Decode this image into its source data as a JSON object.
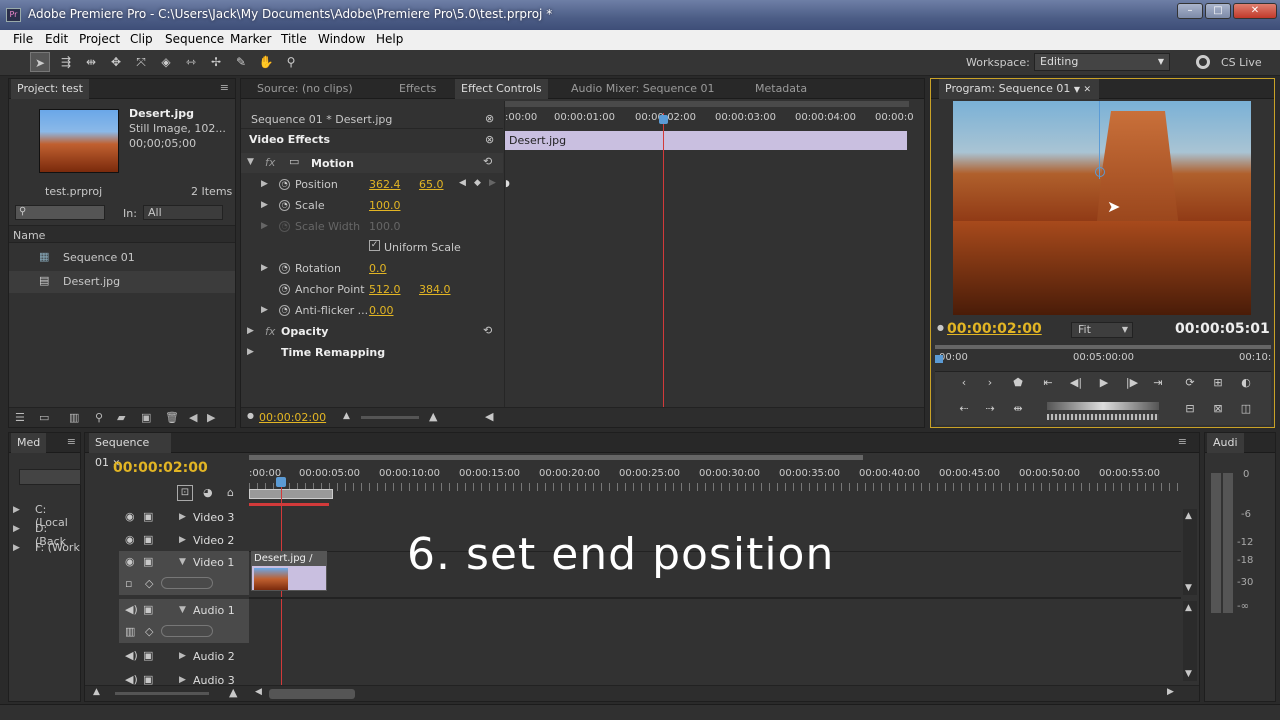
{
  "window": {
    "title": "Adobe Premiere Pro - C:\\Users\\Jack\\My Documents\\Adobe\\Premiere Pro\\5.0\\test.prproj *",
    "logo": "Pr",
    "min": "–",
    "max": "□",
    "close": "✕"
  },
  "menu": [
    "File",
    "Edit",
    "Project",
    "Clip",
    "Sequence",
    "Marker",
    "Title",
    "Window",
    "Help"
  ],
  "toolbar": {
    "workspace_label": "Workspace:",
    "workspace_value": "Editing",
    "cslive": "CS Live"
  },
  "project": {
    "tab": "Project: test",
    "clip_name": "Desert.jpg",
    "clip_type": "Still Image, 102...",
    "clip_duration": "00;00;05;00",
    "project_file": "test.prproj",
    "items_count": "2 Items",
    "in_label": "In:",
    "in_value": "All",
    "name_header": "Name",
    "items": [
      "Sequence 01",
      "Desert.jpg"
    ]
  },
  "source_tabs": [
    "Source: (no clips)",
    "Effects",
    "Effect Controls",
    "Audio Mixer: Sequence 01",
    "Metadata"
  ],
  "effect_controls": {
    "sequence_clip": "Sequence 01 * Desert.jpg",
    "timecodes": [
      ":00:00",
      "00:00:01:00",
      "00:00:02:00",
      "00:00:03:00",
      "00:00:04:00",
      "00:00:0"
    ],
    "clip_bar": "Desert.jpg",
    "video_effects": "Video Effects",
    "fx": "fx",
    "motion": "Motion",
    "position": {
      "label": "Position",
      "x": "362.4",
      "y": "65.0"
    },
    "scale": {
      "label": "Scale",
      "value": "100.0"
    },
    "scale_width": {
      "label": "Scale Width",
      "value": "100.0"
    },
    "uniform_scale": "Uniform Scale",
    "rotation": {
      "label": "Rotation",
      "value": "0.0"
    },
    "anchor": {
      "label": "Anchor Point",
      "x": "512.0",
      "y": "384.0"
    },
    "antiflicker": {
      "label": "Anti-flicker ...",
      "value": "0.00"
    },
    "opacity": "Opacity",
    "time_remap": "Time Remapping",
    "current_time": "00:00:02:00"
  },
  "program": {
    "tab": "Program: Sequence 01",
    "current_time": "00:00:02:00",
    "fit": "Fit",
    "duration": "00:00:05:01",
    "ruler": [
      "00:00",
      "00:05:00:00",
      "00:10:"
    ]
  },
  "media_tab": "Med",
  "drives": [
    "C: (Local",
    "D: (Back",
    "F: (Work"
  ],
  "timeline": {
    "tab": "Sequence 01",
    "current_time": "00:00:02:00",
    "ticks": [
      ":00:00",
      "00:00:05:00",
      "00:00:10:00",
      "00:00:15:00",
      "00:00:20:00",
      "00:00:25:00",
      "00:00:30:00",
      "00:00:35:00",
      "00:00:40:00",
      "00:00:45:00",
      "00:00:50:00",
      "00:00:55:00"
    ],
    "tracks": {
      "v3": "Video 3",
      "v2": "Video 2",
      "v1": "Video 1",
      "a1": "Audio 1",
      "a2": "Audio 2",
      "a3": "Audio 3"
    },
    "clip": "Desert.jpg",
    "clip_suffix": "/"
  },
  "overlay_caption": "6. set end position",
  "audio_meter": {
    "tab": "Audi",
    "labels": [
      "0",
      "-6",
      "-12",
      "-18",
      "-30",
      "-∞"
    ]
  },
  "colors": {
    "accent": "#e2b524",
    "playhead": "#d23a3a",
    "clip": "#c9bfe0"
  }
}
